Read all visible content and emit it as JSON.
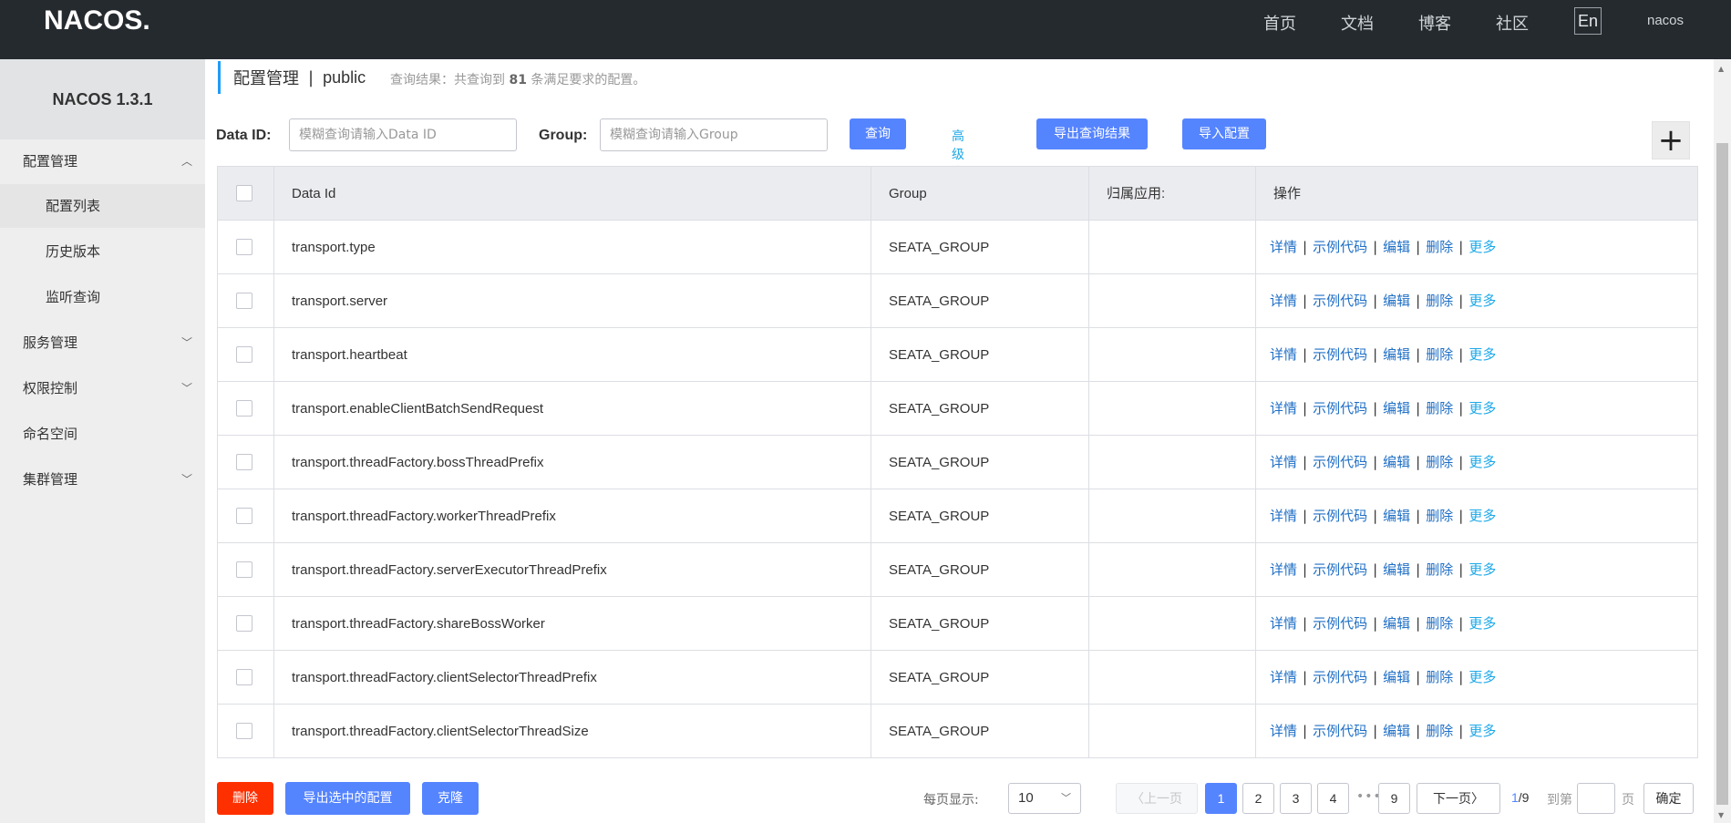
{
  "topbar": {
    "logo": "NACOS.",
    "nav": [
      "首页",
      "文档",
      "博客",
      "社区"
    ],
    "lang": "En",
    "user": "nacos"
  },
  "sidebar": {
    "title": "NACOS 1.3.1",
    "items": [
      {
        "label": "配置管理",
        "expanded": true
      },
      {
        "label": "配置列表"
      },
      {
        "label": "历史版本"
      },
      {
        "label": "监听查询"
      },
      {
        "label": "服务管理"
      },
      {
        "label": "权限控制"
      },
      {
        "label": "命名空间"
      },
      {
        "label": "集群管理"
      }
    ]
  },
  "breadcrumb": {
    "title": "配置管理",
    "separator": "|",
    "namespace": "public",
    "result_prefix": "查询结果：共查询到",
    "result_count": "81",
    "result_suffix": "条满足要求的配置。"
  },
  "search": {
    "dataid_label": "Data ID:",
    "dataid_placeholder": "模糊查询请输入Data ID",
    "group_label": "Group:",
    "group_placeholder": "模糊查询请输入Group",
    "query_button": "查询",
    "advanced_link": "高级查询",
    "export_button": "导出查询结果",
    "import_button": "导入配置",
    "add_icon": "plus-icon"
  },
  "table": {
    "headers": [
      "Data Id",
      "Group",
      "归属应用:",
      "操作"
    ],
    "ops": [
      "详情",
      "示例代码",
      "编辑",
      "删除",
      "更多"
    ],
    "rows": [
      {
        "data_id": "transport.type",
        "group": "SEATA_GROUP",
        "app": ""
      },
      {
        "data_id": "transport.server",
        "group": "SEATA_GROUP",
        "app": ""
      },
      {
        "data_id": "transport.heartbeat",
        "group": "SEATA_GROUP",
        "app": ""
      },
      {
        "data_id": "transport.enableClientBatchSendRequest",
        "group": "SEATA_GROUP",
        "app": ""
      },
      {
        "data_id": "transport.threadFactory.bossThreadPrefix",
        "group": "SEATA_GROUP",
        "app": ""
      },
      {
        "data_id": "transport.threadFactory.workerThreadPrefix",
        "group": "SEATA_GROUP",
        "app": ""
      },
      {
        "data_id": "transport.threadFactory.serverExecutorThreadPrefix",
        "group": "SEATA_GROUP",
        "app": ""
      },
      {
        "data_id": "transport.threadFactory.shareBossWorker",
        "group": "SEATA_GROUP",
        "app": ""
      },
      {
        "data_id": "transport.threadFactory.clientSelectorThreadPrefix",
        "group": "SEATA_GROUP",
        "app": ""
      },
      {
        "data_id": "transport.threadFactory.clientSelectorThreadSize",
        "group": "SEATA_GROUP",
        "app": ""
      }
    ]
  },
  "footer": {
    "delete_button": "删除",
    "export_selected_button": "导出选中的配置",
    "clone_button": "克隆",
    "page_size_label": "每页显示:",
    "page_size": "10",
    "prev": "上一页",
    "pages": [
      "1",
      "2",
      "3",
      "4"
    ],
    "ellipsis": "•••",
    "last_page": "9",
    "next": "下一页",
    "current_page": "1",
    "total_pages": "/9",
    "goto_label": "到第",
    "goto_unit": "页",
    "confirm": "确定"
  },
  "colors": {
    "primary": "#5584ff",
    "danger": "#ff3000",
    "link": "#1f6fc6",
    "topbar": "#252a2f"
  }
}
